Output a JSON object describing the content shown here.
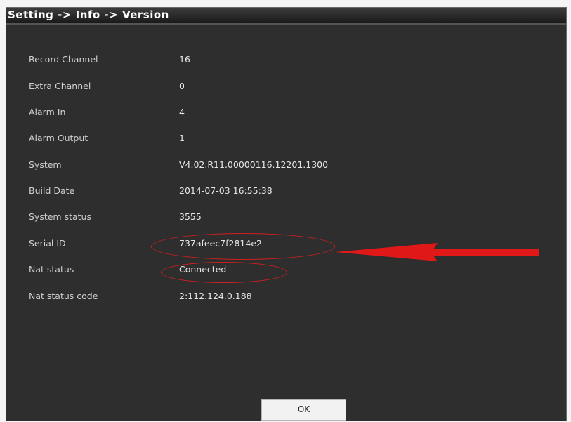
{
  "window": {
    "title": "Setting -> Info -> Version"
  },
  "info": {
    "rows": [
      {
        "label": "Record Channel",
        "value": "16"
      },
      {
        "label": "Extra Channel",
        "value": "0"
      },
      {
        "label": "Alarm In",
        "value": "4"
      },
      {
        "label": "Alarm Output",
        "value": "1"
      },
      {
        "label": "System",
        "value": "V4.02.R11.00000116.12201.1300"
      },
      {
        "label": "Build Date",
        "value": "2014-07-03 16:55:38"
      },
      {
        "label": "System status",
        "value": "3555"
      },
      {
        "label": "Serial ID",
        "value": "737afeec7f2814e2"
      },
      {
        "label": "Nat status",
        "value": "Connected"
      },
      {
        "label": "Nat status code",
        "value": "2:112.124.0.188"
      }
    ]
  },
  "footer": {
    "ok_label": "OK"
  },
  "colors": {
    "window_bg": "#2e2e2e",
    "annotation": "#d02020"
  },
  "annotations": {
    "highlighted_fields": [
      "Serial ID",
      "Nat status"
    ],
    "arrow_target": "Serial ID",
    "arrow_icon": "red-arrow-icon"
  }
}
